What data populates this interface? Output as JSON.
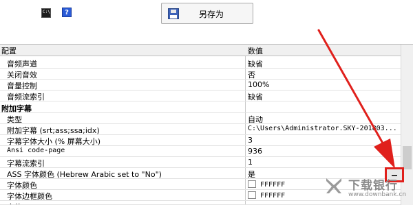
{
  "toolbar": {
    "cmd_icon": "command-prompt-icon",
    "help_icon": "help-icon",
    "help_glyph": "?",
    "saveas_label": "另存为",
    "saveas_icon": "floppy-disk-icon"
  },
  "grid": {
    "header": {
      "name": "配置",
      "value": "数值"
    },
    "rows": [
      {
        "name": "音频声道",
        "value": "缺省"
      },
      {
        "name": "关闭音效",
        "value": "否"
      },
      {
        "name": "音量控制",
        "value": "100%"
      },
      {
        "name": "音频流索引",
        "value": "缺省"
      },
      {
        "name": "附加字幕",
        "value": ""
      },
      {
        "name": "类型",
        "value": "自动"
      },
      {
        "name": "附加字幕 (srt;ass;ssa;idx)",
        "value": "C:\\Users\\Administrator.SKY-201803..."
      },
      {
        "name": "字幕字体大小 (% 屏幕大小)",
        "value": "3"
      },
      {
        "name": "Ansi code-page",
        "value": "936"
      },
      {
        "name": "字幕流索引",
        "value": "1"
      },
      {
        "name": "ASS 字体颜色 (Hebrew Arabic set to \"No\")",
        "value": "是"
      },
      {
        "name": "字体颜色",
        "value": "FFFFFF"
      },
      {
        "name": "字体边框颜色",
        "value": "FFFFFF"
      },
      {
        "name": "字体",
        "value": ""
      }
    ],
    "ellipsis_icon": "ellipsis-button-icon"
  },
  "annotation": {
    "color": "#e0201c",
    "arrow_icon": "red-arrow-icon"
  },
  "watermark": {
    "text": "下载银行",
    "url": "www.downbank.cn"
  }
}
